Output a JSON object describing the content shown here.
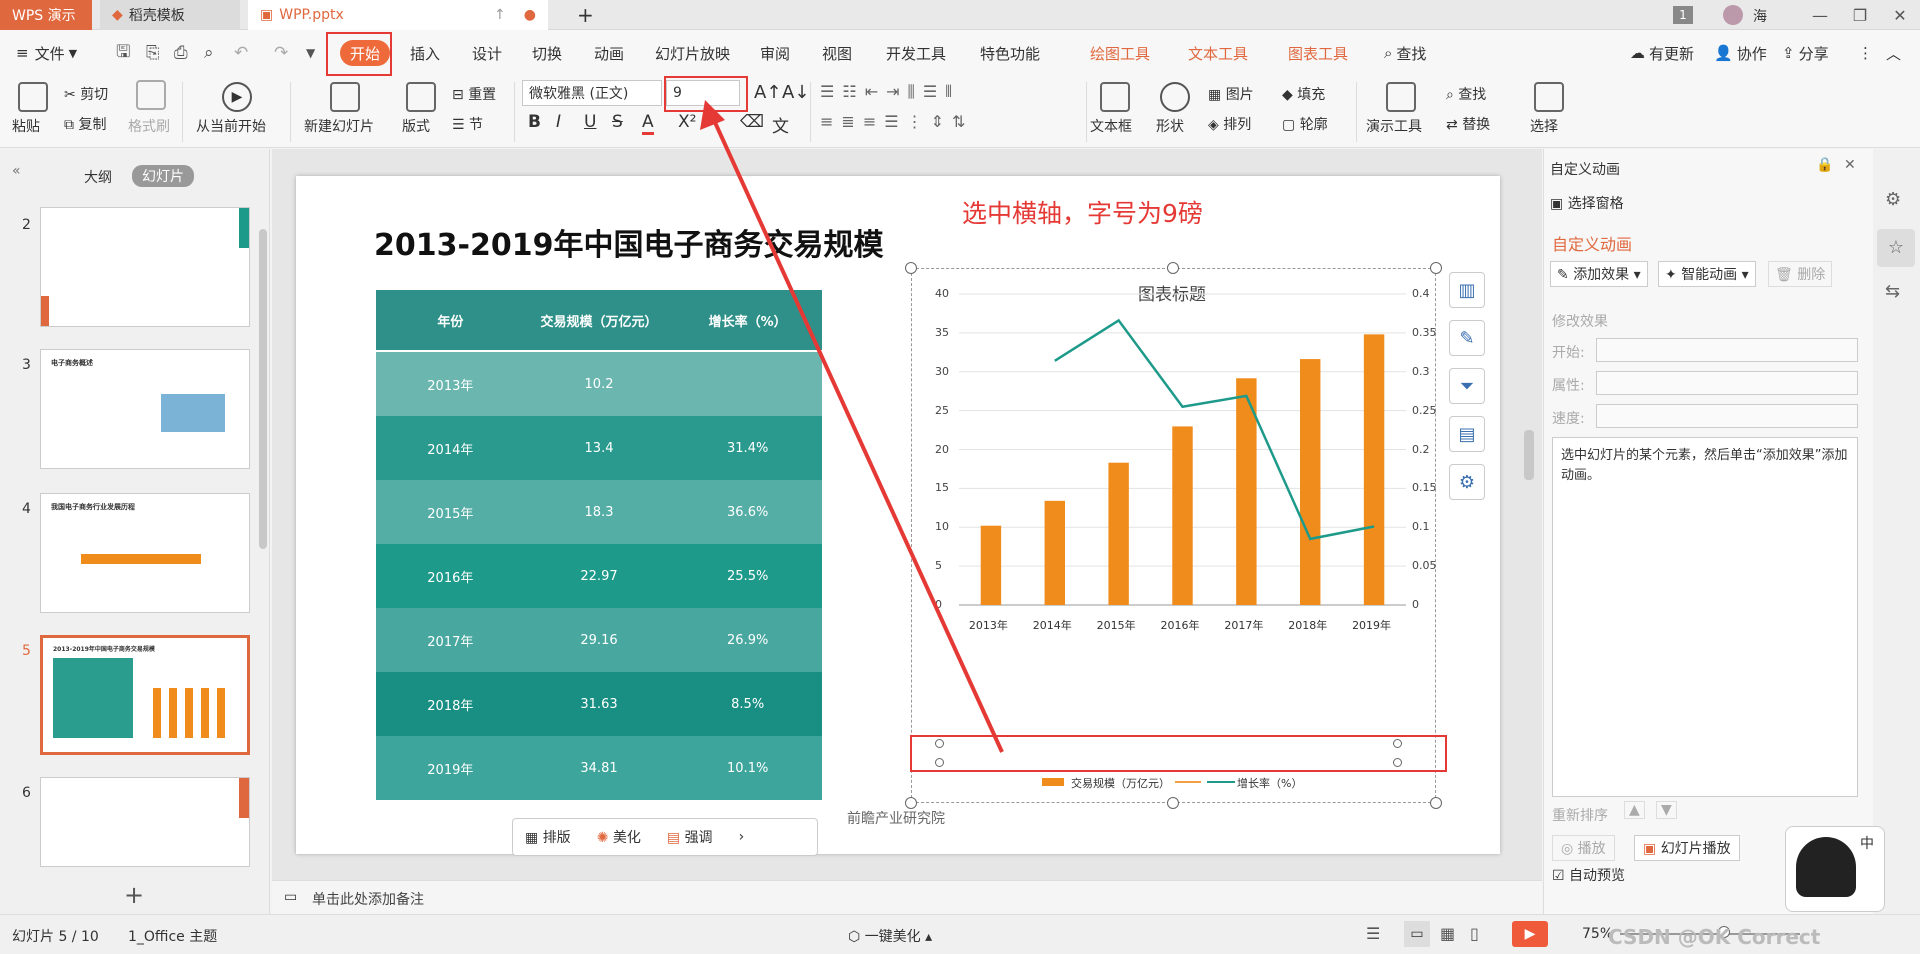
{
  "tabs": {
    "app": "WPS 演示",
    "daoke": "稻壳模板",
    "file": "WPP.pptx",
    "add": "+",
    "page_badge": "1",
    "user": "海"
  },
  "menu": {
    "hamburger": "≡",
    "file": "文件",
    "start": "开始",
    "insert": "插入",
    "design": "设计",
    "switch": "切换",
    "animation": "动画",
    "slideshow": "幻灯片放映",
    "review": "审阅",
    "view": "视图",
    "dev": "开发工具",
    "special": "特色功能",
    "draw_tools": "绘图工具",
    "text_tools": "文本工具",
    "chart_tools": "图表工具",
    "search": "查找",
    "update": "有更新",
    "collab": "协作",
    "share": "分享"
  },
  "ribbon": {
    "paste": "粘贴",
    "cut": "剪切",
    "copy": "复制",
    "format_brush": "格式刷",
    "from_current": "从当前开始",
    "new_slide": "新建幻灯片",
    "layout": "版式",
    "reset": "重置",
    "section": "节",
    "font_name": "微软雅黑 (正文)",
    "font_size": "9",
    "textbox": "文本框",
    "shape": "形状",
    "picture": "图片",
    "arrange": "排列",
    "fill": "填充",
    "outline": "轮廓",
    "present_tools": "演示工具",
    "find": "查找",
    "replace": "替换",
    "select": "选择"
  },
  "left": {
    "outline_tab": "大纲",
    "slides_tab": "幻灯片",
    "thumbs": [
      {
        "num": "2"
      },
      {
        "num": "3",
        "title": "电子商务概述"
      },
      {
        "num": "4",
        "title": "我国电子商务行业发展历程"
      },
      {
        "num": "5",
        "title": "2013-2019年中国电子商务交易规模"
      },
      {
        "num": "6"
      }
    ],
    "add": "+"
  },
  "slide": {
    "title": "2013-2019年中国电子商务交易规模",
    "annotation": "选中横轴，字号为9磅",
    "source": "前瞻产业研究院",
    "table": {
      "headers": [
        "年份",
        "交易规模（万亿元）",
        "增长率（%）"
      ],
      "rows": [
        [
          "2013年",
          "10.2",
          ""
        ],
        [
          "2014年",
          "13.4",
          "31.4%"
        ],
        [
          "2015年",
          "18.3",
          "36.6%"
        ],
        [
          "2016年",
          "22.97",
          "25.5%"
        ],
        [
          "2017年",
          "29.16",
          "26.9%"
        ],
        [
          "2018年",
          "31.63",
          "8.5%"
        ],
        [
          "2019年",
          "34.81",
          "10.1%"
        ]
      ]
    },
    "float_toolbar": {
      "layout": "排版",
      "beautify": "美化",
      "emphasis": "强调"
    }
  },
  "chart_data": {
    "type": "bar",
    "title": "图表标题",
    "categories": [
      "2013年",
      "2014年",
      "2015年",
      "2016年",
      "2017年",
      "2018年",
      "2019年"
    ],
    "series": [
      {
        "name": "交易规模（万亿元）",
        "values": [
          10.2,
          13.4,
          18.3,
          22.97,
          29.16,
          31.63,
          34.81
        ],
        "color": "#f08c1c"
      },
      {
        "name": "增长率（%）",
        "type": "line",
        "axis": "right",
        "values": [
          null,
          0.314,
          0.366,
          0.255,
          0.269,
          0.085,
          0.101
        ],
        "color": "#1e9a8a"
      }
    ],
    "ylim": [
      0,
      40
    ],
    "y2lim": [
      0,
      0.4
    ],
    "yticks": [
      "0",
      "5",
      "10",
      "15",
      "20",
      "25",
      "30",
      "35",
      "40"
    ],
    "y2ticks": [
      "0",
      "0.05",
      "0.1",
      "0.15",
      "0.2",
      "0.25",
      "0.3",
      "0.35",
      "0.4"
    ],
    "legend": "bottom"
  },
  "rightpanel": {
    "title": "自定义动画",
    "select_pane": "选择窗格",
    "section_title": "自定义动画",
    "add_effect": "添加效果",
    "smart_anim": "智能动画",
    "delete": "删除",
    "modify": "修改效果",
    "start": "开始:",
    "property": "属性:",
    "speed": "速度:",
    "hint": "选中幻灯片的某个元素，然后单击“添加效果”添加动画。",
    "reorder": "重新排序",
    "play": "播放",
    "slideshow": "幻灯片播放",
    "autopreview": "自动预览"
  },
  "notes": {
    "placeholder": "单击此处添加备注"
  },
  "status": {
    "slide_pos": "幻灯片 5 / 10",
    "theme": "1_Office 主题",
    "beautify": "一键美化",
    "zoom": "75%",
    "watermark": "CSDN @OK Correct"
  },
  "colors": {
    "accent": "#e0683f",
    "teal": "#1e9a8a",
    "bar": "#f08c1c",
    "annot": "#e53935"
  }
}
